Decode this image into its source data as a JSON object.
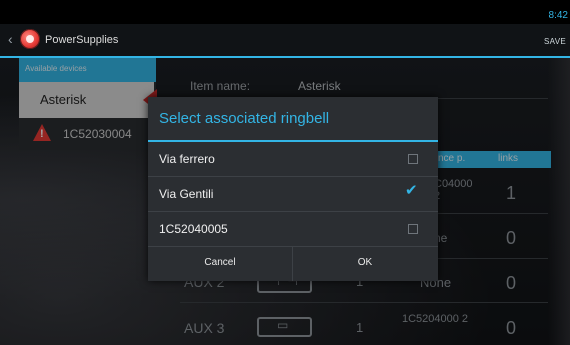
{
  "status_bar": {
    "clock": "8:42"
  },
  "action_bar": {
    "title": "PowerSupplies",
    "save_label": "SAVE"
  },
  "device_panel": {
    "header": "Available devices",
    "selected_device": "Asterisk",
    "alert_device": "1C52030004"
  },
  "background_form": {
    "item_name_label": "Item name:",
    "item_name_value": "Asterisk",
    "table_headers": {
      "device_partial": "nce p.",
      "links": "links"
    },
    "rows": [
      {
        "name": "",
        "count": "",
        "device": "C04000 2",
        "links": "1"
      },
      {
        "name": "",
        "count": "",
        "device": "ne",
        "links": "0"
      },
      {
        "name": "AUX 2",
        "count": "1",
        "device": "None",
        "links": "0"
      },
      {
        "name": "AUX 3",
        "count": "1",
        "device": "1C5204000 2",
        "links": "0"
      }
    ]
  },
  "dialog": {
    "title": "Select associated ringbell",
    "options": [
      {
        "label": "Via ferrero",
        "checked": false
      },
      {
        "label": "Via Gentili",
        "checked": true
      },
      {
        "label": "1C52040005",
        "checked": false
      }
    ],
    "cancel_label": "Cancel",
    "ok_label": "OK"
  },
  "colors": {
    "accent": "#33b5e5",
    "alert": "#e53935",
    "dialog_bg": "#2b2e32"
  }
}
